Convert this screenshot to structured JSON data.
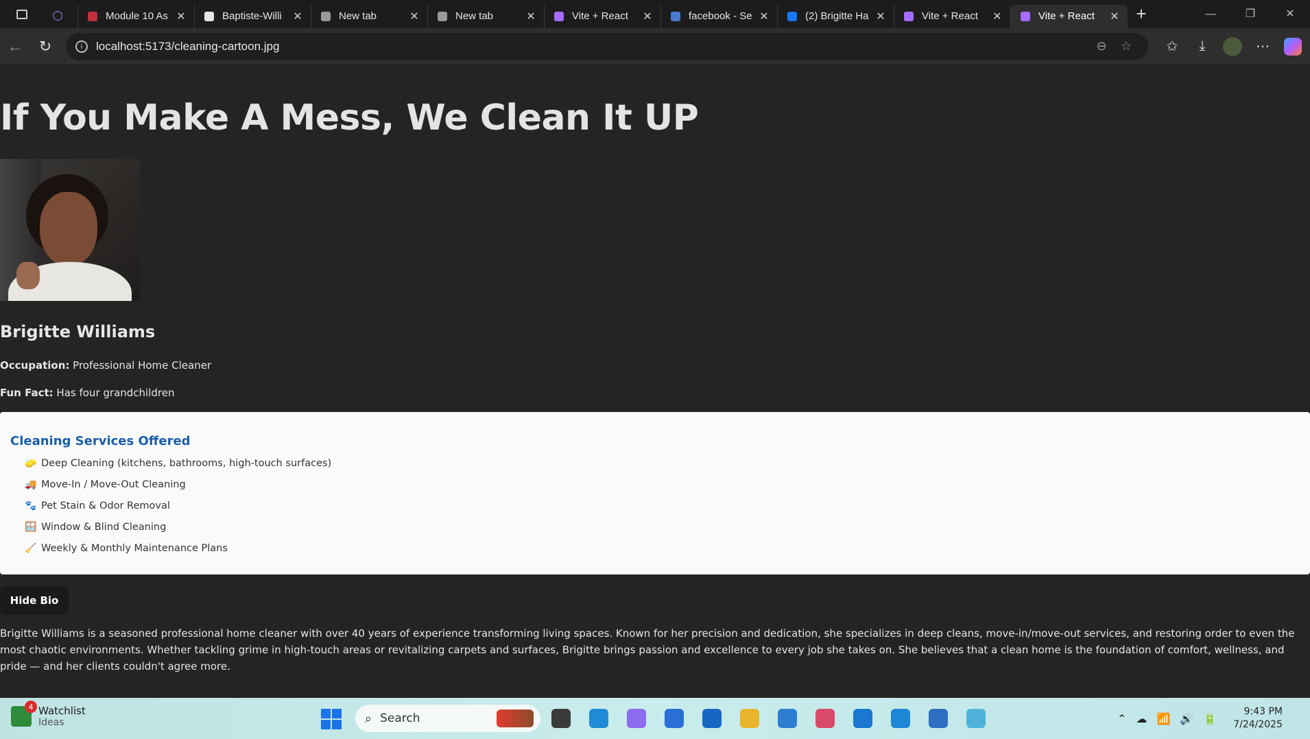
{
  "browser": {
    "tabs": [
      {
        "title": "Module 10 As",
        "icon": "module-icon",
        "color": "#c0303a"
      },
      {
        "title": "Baptiste-Willi",
        "icon": "github-icon",
        "color": "#e6e6e6"
      },
      {
        "title": "New tab",
        "icon": "newtab-icon",
        "color": "#9a9a9a"
      },
      {
        "title": "New tab",
        "icon": "newtab-icon",
        "color": "#9a9a9a"
      },
      {
        "title": "Vite + React",
        "icon": "vite-icon",
        "color": "#a66bff"
      },
      {
        "title": "facebook - Se",
        "icon": "search-icon",
        "color": "#4a7bd0"
      },
      {
        "title": "(2) Brigitte Ha",
        "icon": "facebook-icon",
        "color": "#1877f2"
      },
      {
        "title": "Vite + React",
        "icon": "vite-icon",
        "color": "#a66bff"
      },
      {
        "title": "Vite + React",
        "icon": "vite-icon",
        "color": "#a66bff"
      }
    ],
    "active_tab_index": 8,
    "url": "localhost:5173/cleaning-cartoon.jpg"
  },
  "page": {
    "headline": "If You Make A Mess, We Clean It UP",
    "name": "Brigitte Williams",
    "occupation_label": "Occupation:",
    "occupation_value": "Professional Home Cleaner",
    "funfact_label": "Fun Fact:",
    "funfact_value": "Has four grandchildren",
    "services_title": "Cleaning Services Offered",
    "services": [
      {
        "emoji": "🧽",
        "text": "Deep Cleaning (kitchens, bathrooms, high-touch surfaces)"
      },
      {
        "emoji": "🚚",
        "text": "Move-In / Move-Out Cleaning"
      },
      {
        "emoji": "🐾",
        "text": "Pet Stain & Odor Removal"
      },
      {
        "emoji": "🪟",
        "text": "Window & Blind Cleaning"
      },
      {
        "emoji": "🧹",
        "text": "Weekly & Monthly Maintenance Plans"
      }
    ],
    "hide_button": "Hide Bio",
    "bio": "Brigitte Williams is a seasoned professional home cleaner with over 40 years of experience transforming living spaces. Known for her precision and dedication, she specializes in deep cleans, move-in/move-out services, and restoring order to even the most chaotic environments. Whether tackling grime in high-touch areas or revitalizing carpets and surfaces, Brigitte brings passion and excellence to every job she takes on. She believes that a clean home is the foundation of comfort, wellness, and pride — and her clients couldn't agree more."
  },
  "taskbar": {
    "widget_title": "Watchlist",
    "widget_subtitle": "Ideas",
    "widget_badge": "4",
    "search_placeholder": "Search",
    "time": "9:43 PM",
    "date": "7/24/2025",
    "apps": [
      {
        "name": "file-explorer-dark-icon",
        "color": "#3a3a3a"
      },
      {
        "name": "edge-icon",
        "color": "#1f8bd6"
      },
      {
        "name": "copilot-icon",
        "color": "#8c6cf0"
      },
      {
        "name": "store-icon",
        "color": "#2a6fd6"
      },
      {
        "name": "outlook-icon",
        "color": "#1667c4"
      },
      {
        "name": "folder-icon",
        "color": "#e8b52c"
      },
      {
        "name": "remote-icon",
        "color": "#2c7fd0"
      },
      {
        "name": "snipping-icon",
        "color": "#d94a6a"
      },
      {
        "name": "cortana-icon",
        "color": "#1a78d0"
      },
      {
        "name": "vscode-icon",
        "color": "#1e86d6"
      },
      {
        "name": "notepad-icon",
        "color": "#2f6fc2"
      },
      {
        "name": "git-icon",
        "color": "#4fb3d9"
      }
    ]
  }
}
